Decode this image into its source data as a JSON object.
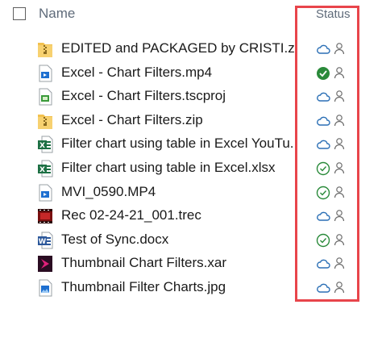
{
  "header": {
    "name_label": "Name",
    "status_label": "Status",
    "sort_caret": "⌃"
  },
  "files": [
    {
      "name": "EDITED and PACKAGED by CRISTI.zip",
      "type": "zip",
      "status": "cloud"
    },
    {
      "name": "Excel - Chart Filters.mp4",
      "type": "mp4",
      "status": "synced-solid"
    },
    {
      "name": "Excel - Chart Filters.tscproj",
      "type": "tscproj",
      "status": "cloud"
    },
    {
      "name": "Excel - Chart Filters.zip",
      "type": "zip",
      "status": "cloud"
    },
    {
      "name": "Filter chart using table in Excel YouTu...",
      "type": "excel",
      "status": "cloud"
    },
    {
      "name": "Filter chart using table in Excel.xlsx",
      "type": "excel",
      "status": "synced-outline"
    },
    {
      "name": "MVI_0590.MP4",
      "type": "mp4",
      "status": "synced-outline"
    },
    {
      "name": "Rec 02-24-21_001.trec",
      "type": "trec",
      "status": "cloud"
    },
    {
      "name": "Test of Sync.docx",
      "type": "word",
      "status": "synced-outline"
    },
    {
      "name": "Thumbnail Chart Filters.xar",
      "type": "xar",
      "status": "cloud"
    },
    {
      "name": "Thumbnail Filter Charts.jpg",
      "type": "jpg",
      "status": "cloud"
    }
  ],
  "colors": {
    "cloud": "#2b6fb5",
    "synced": "#2a8a3a",
    "highlight": "#e8454b"
  }
}
